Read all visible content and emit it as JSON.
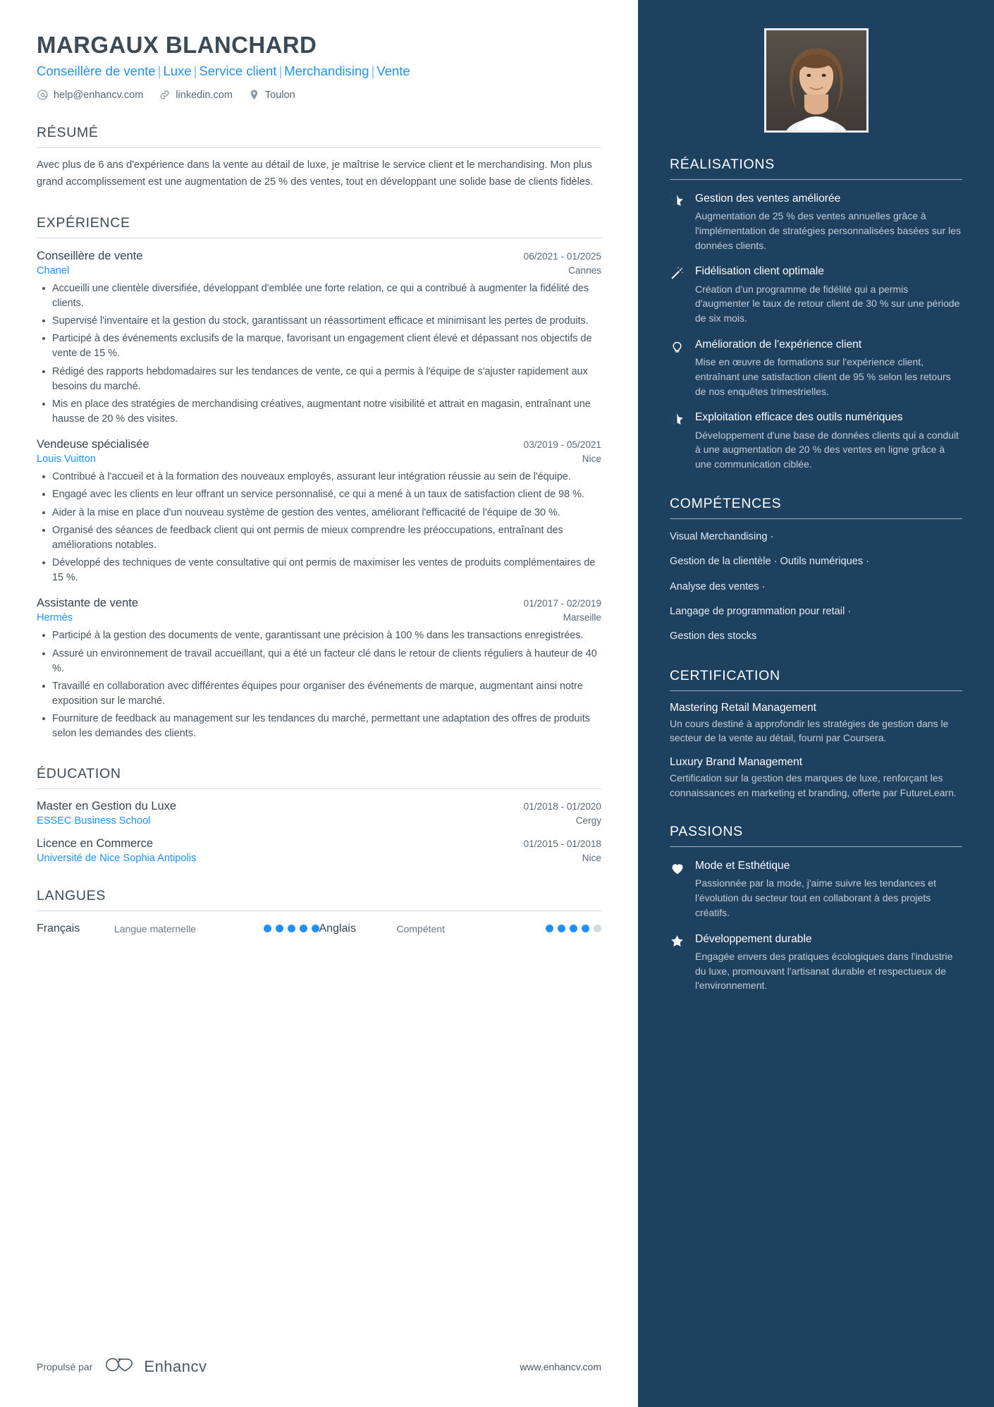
{
  "header": {
    "name": "MARGAUX BLANCHARD",
    "headline_parts": [
      "Conseillère de vente",
      "Luxe",
      "Service client",
      "Merchandising",
      "Vente"
    ],
    "headline_separator": "|",
    "contacts": [
      {
        "icon": "at-icon",
        "text": "help@enhancv.com"
      },
      {
        "icon": "link-icon",
        "text": "linkedin.com"
      },
      {
        "icon": "location-pin-icon",
        "text": "Toulon"
      }
    ]
  },
  "summary": {
    "title": "RÉSUMÉ",
    "text": "Avec plus de 6 ans d'expérience dans la vente au détail de luxe, je maîtrise le service client et le merchandising. Mon plus grand accomplissement est une augmentation de 25 % des ventes, tout en développant une solide base de clients fidèles."
  },
  "experience": {
    "title": "EXPÉRIENCE",
    "entries": [
      {
        "role": "Conseillère de vente",
        "dates": "06/2021 - 01/2025",
        "company": "Chanel",
        "location": "Cannes",
        "bullets": [
          "Accueilli une clientèle diversifiée, développant d'emblée une forte relation, ce qui a contribué à augmenter la fidélité des clients.",
          "Supervisé l'inventaire et la gestion du stock, garantissant un réassortiment efficace et minimisant les pertes de produits.",
          "Participé à des événements exclusifs de la marque, favorisant un engagement client élevé et dépassant nos objectifs de vente de 15 %.",
          "Rédigé des rapports hebdomadaires sur les tendances de vente, ce qui a permis à l'équipe de s'ajuster rapidement aux besoins du marché.",
          "Mis en place des stratégies de merchandising créatives, augmentant notre visibilité et attrait en magasin, entraînant une hausse de 20 % des visites."
        ]
      },
      {
        "role": "Vendeuse spécialisée",
        "dates": "03/2019 - 05/2021",
        "company": "Louis Vuitton",
        "location": "Nice",
        "bullets": [
          "Contribué à l'accueil et à la formation des nouveaux employés, assurant leur intégration réussie au sein de l'équipe.",
          "Engagé avec les clients en leur offrant un service personnalisé, ce qui a mené à un taux de satisfaction client de 98 %.",
          "Aider à la mise en place d'un nouveau système de gestion des ventes, améliorant l'efficacité de l'équipe de 30 %.",
          "Organisé des séances de feedback client qui ont permis de mieux comprendre les préoccupations, entraînant des améliorations notables.",
          "Développé des techniques de vente consultative qui ont permis de maximiser les ventes de produits complémentaires de 15 %."
        ]
      },
      {
        "role": "Assistante de vente",
        "dates": "01/2017 - 02/2019",
        "company": "Hermès",
        "location": "Marseille",
        "bullets": [
          "Participé à la gestion des documents de vente, garantissant une précision à 100 % dans les transactions enregistrées.",
          "Assuré un environnement de travail accueillant, qui a été un facteur clé dans le retour de clients réguliers à hauteur de 40 %.",
          "Travaillé en collaboration avec différentes équipes pour organiser des événements de marque, augmentant ainsi notre exposition sur le marché.",
          "Fourniture de feedback au management sur les tendances du marché, permettant une adaptation des offres de produits selon les demandes des clients."
        ]
      }
    ]
  },
  "education": {
    "title": "ÉDUCATION",
    "entries": [
      {
        "degree": "Master en Gestion du Luxe",
        "dates": "01/2018 - 01/2020",
        "school": "ESSEC Business School",
        "location": "Cergy"
      },
      {
        "degree": "Licence en Commerce",
        "dates": "01/2015 - 01/2018",
        "school": "Université de Nice Sophia Antipolis",
        "location": "Nice"
      }
    ]
  },
  "languages": {
    "title": "LANGUES",
    "items": [
      {
        "name": "Français",
        "level": "Langue maternelle",
        "filled": 5,
        "total": 5
      },
      {
        "name": "Anglais",
        "level": "Compétent",
        "filled": 4,
        "total": 5
      }
    ]
  },
  "footer": {
    "powered_by": "Propulsé par",
    "brand": "Enhancv",
    "url": "www.enhancv.com"
  },
  "sidebar": {
    "achievements": {
      "title": "RÉALISATIONS",
      "items": [
        {
          "icon": "star-icon",
          "title": "Gestion des ventes améliorée",
          "desc": "Augmentation de 25 % des ventes annuelles grâce à l'implémentation de stratégies personnalisées basées sur les données clients."
        },
        {
          "icon": "magic-wand-icon",
          "title": "Fidélisation client optimale",
          "desc": "Création d'un programme de fidélité qui a permis d'augmenter le taux de retour client de 30 % sur une période de six mois."
        },
        {
          "icon": "lightbulb-icon",
          "title": "Amélioration de l'expérience client",
          "desc": "Mise en œuvre de formations sur l'expérience client, entraînant une satisfaction client de 95 % selon les retours de nos enquêtes trimestrielles."
        },
        {
          "icon": "star-icon",
          "title": "Exploitation efficace des outils numériques",
          "desc": "Développement d'une base de données clients qui a conduit à une augmentation de 20 % des ventes en ligne grâce à une communication ciblée."
        }
      ]
    },
    "skills": {
      "title": "COMPÉTENCES",
      "lines": [
        "Visual Merchandising ·",
        "Gestion de la clientèle · Outils numériques ·",
        "Analyse des ventes ·",
        "Langage de programmation pour retail ·",
        "Gestion des stocks"
      ]
    },
    "certification": {
      "title": "CERTIFICATION",
      "items": [
        {
          "name": "Mastering Retail Management",
          "desc": "Un cours destiné à approfondir les stratégies de gestion dans le secteur de la vente au détail, fourni par Coursera."
        },
        {
          "name": "Luxury Brand Management",
          "desc": "Certification sur la gestion des marques de luxe, renforçant les connaissances en marketing et branding, offerte par FutureLearn."
        }
      ]
    },
    "passions": {
      "title": "PASSIONS",
      "items": [
        {
          "icon": "heart-icon",
          "title": "Mode et Esthétique",
          "desc": "Passionnée par la mode, j'aime suivre les tendances et l'évolution du secteur tout en collaborant à des projets créatifs."
        },
        {
          "icon": "star-filled-icon",
          "title": "Développement durable",
          "desc": "Engagée envers des pratiques écologiques dans l'industrie du luxe, promouvant l'artisanat durable et respectueux de l'environnement."
        }
      ]
    }
  },
  "colors": {
    "accent_blue": "#1e90ff",
    "sidebar_bg": "#1f4160",
    "text_dark": "#3c4a56"
  }
}
